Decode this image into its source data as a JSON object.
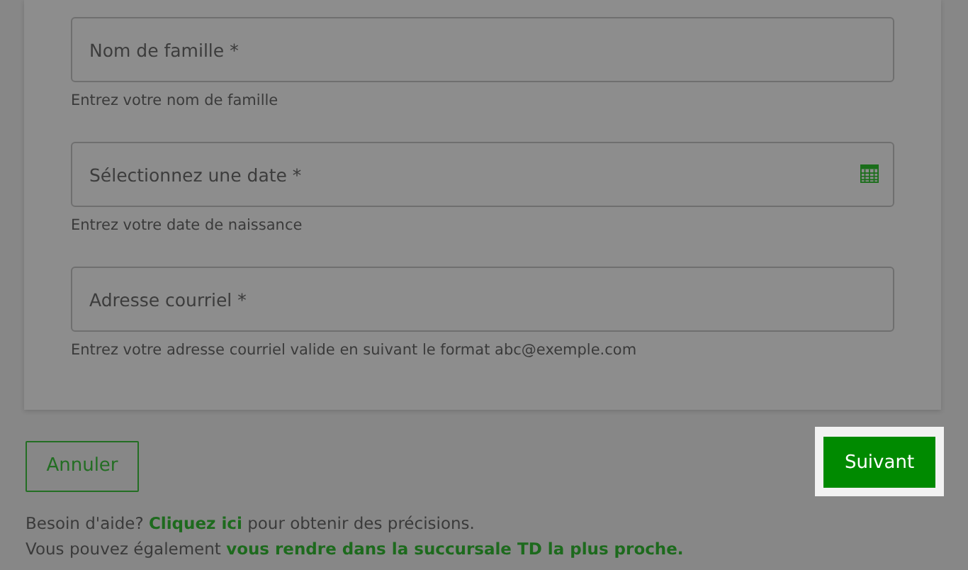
{
  "fields": [
    {
      "kind": "text",
      "placeholder": "Nom de famille *",
      "hint": "Entrez votre nom de famille"
    },
    {
      "kind": "date",
      "placeholder": "Sélectionnez une date *",
      "hint": "Entrez votre date de naissance"
    },
    {
      "kind": "email",
      "placeholder": "Adresse courriel *",
      "hint": "Entrez votre adresse courriel valide en suivant le format abc@exemple.com"
    }
  ],
  "buttons": [
    {
      "label": "Annuler",
      "kind": "secondary",
      "highlighted": false
    },
    {
      "label": "Suivant",
      "kind": "primary",
      "highlighted": true
    }
  ],
  "help": [
    {
      "before": "Besoin d'aide? ",
      "link": "Cliquez ici",
      "after": " pour obtenir des précisions."
    },
    {
      "before": "Vous pouvez également ",
      "link": "vous rendre dans la succursale TD la plus proche."
    }
  ]
}
